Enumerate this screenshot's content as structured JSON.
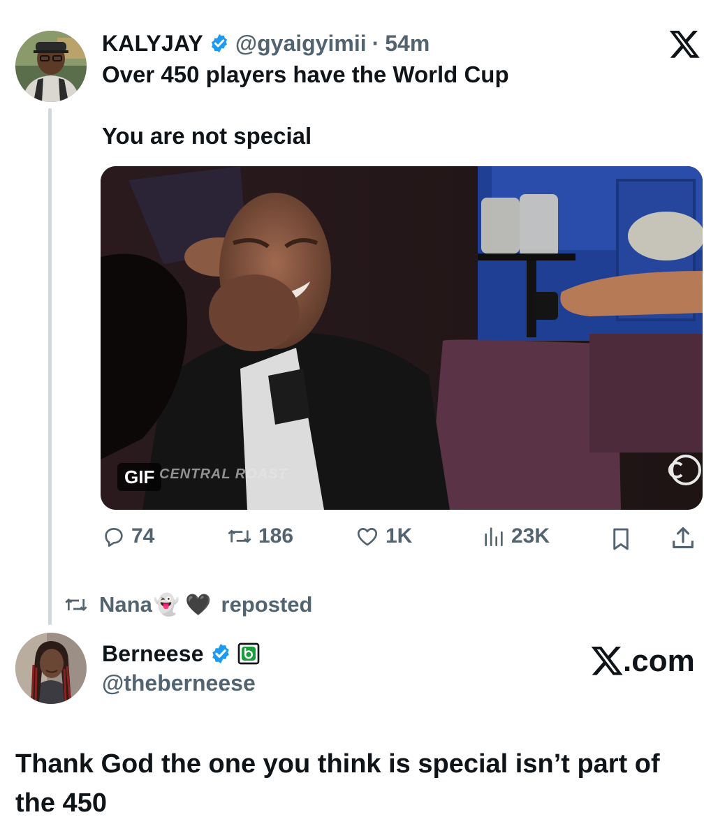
{
  "tweet": {
    "author_name": "KALYJAY",
    "handle": "@gyaigyimii",
    "separator": "·",
    "time": "54m",
    "line1": "Over 450 players have the World Cup",
    "line2": "You are not special",
    "media": {
      "gif_label": "GIF",
      "watermark": "CENTRAL ROAST"
    },
    "stats": {
      "replies": "74",
      "reposts": "186",
      "likes": "1K",
      "views": "23K"
    },
    "icons": {
      "verified": "verified-badge-icon",
      "platform": "x-logo-icon",
      "reply": "reply-icon",
      "repost": "repost-icon",
      "like": "heart-icon",
      "views": "views-icon",
      "bookmark": "bookmark-icon",
      "share": "share-icon"
    }
  },
  "repost_notice": {
    "user": "Nana",
    "emojis": [
      "👻",
      "🖤"
    ],
    "text": "reposted"
  },
  "quote": {
    "author_name": "Berneese",
    "handle": "@theberneese",
    "site": ".com",
    "text": "Thank God the one you think is special isn’t part of the 450"
  },
  "colors": {
    "text": "#0f1419",
    "muted": "#536471",
    "verified": "#1d9bf0",
    "thread_line": "#cfd9de",
    "affiliate_badge": "#1a9e3a"
  }
}
